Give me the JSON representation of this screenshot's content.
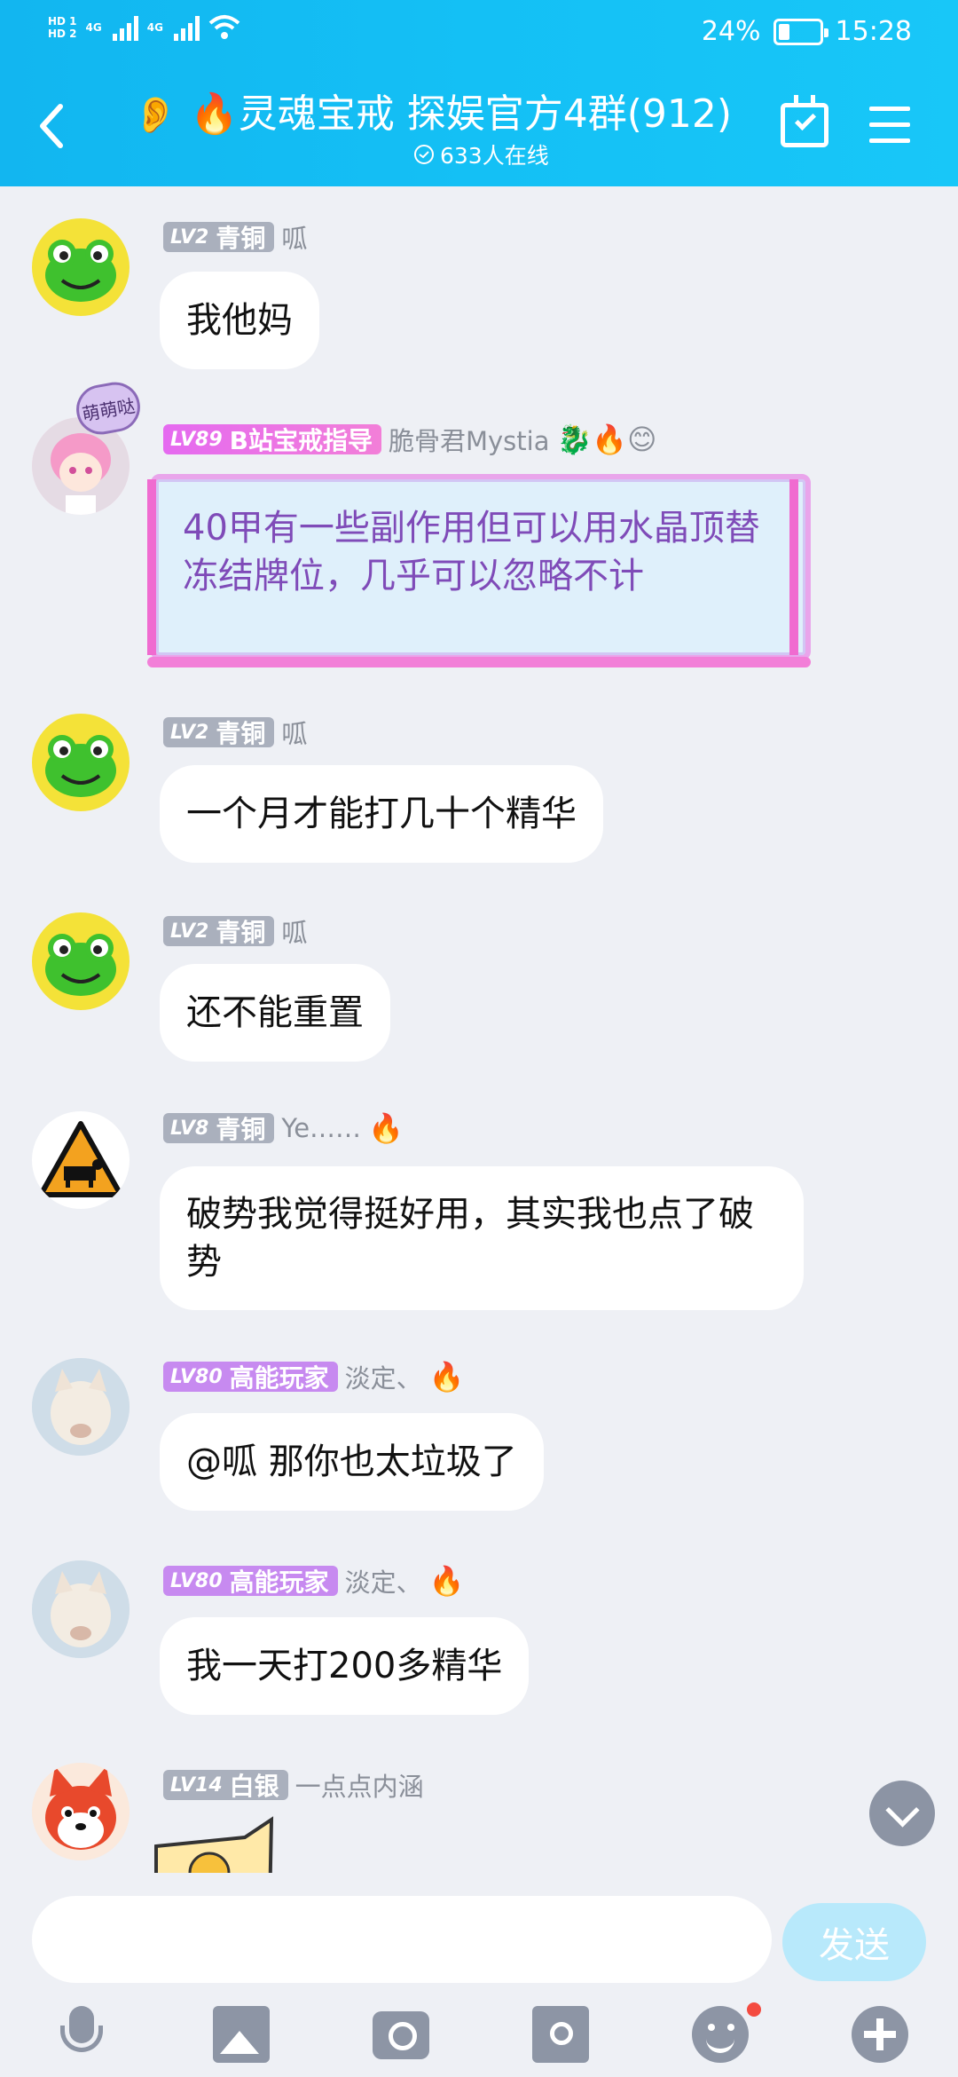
{
  "status": {
    "hd1": "HD 1",
    "hd2": "HD 2",
    "net": "4G",
    "net2": "4G",
    "battery": "24%",
    "time": "15:28"
  },
  "header": {
    "title": "🔥灵魂宝戒 探娱官方4群(912)",
    "online": "633人在线"
  },
  "messages": [
    {
      "lv": "LV2",
      "rank": "青铜",
      "name": "呱",
      "text": "我他妈"
    },
    {
      "lv": "LV89",
      "rank": "B站宝戒指导",
      "name": "脆骨君Mystia",
      "emojis": "🐉🔥😊",
      "text": "40甲有一些副作用但可以用水晶顶替冻结牌位，几乎可以忽略不计"
    },
    {
      "lv": "LV2",
      "rank": "青铜",
      "name": "呱",
      "text": "一个月才能打几十个精华"
    },
    {
      "lv": "LV2",
      "rank": "青铜",
      "name": "呱",
      "text": "还不能重置"
    },
    {
      "lv": "LV8",
      "rank": "青铜",
      "name": "Ye……",
      "emojis": "🔥",
      "text": "破势我觉得挺好用，其实我也点了破势"
    },
    {
      "lv": "LV80",
      "rank": "高能玩家",
      "name": "淡定、",
      "emojis": "🔥",
      "text": "@呱 那你也太垃圾了"
    },
    {
      "lv": "LV80",
      "rank": "高能玩家",
      "name": "淡定、",
      "emojis": "🔥",
      "text": "我一天打200多精华"
    },
    {
      "lv": "LV14",
      "rank": "白银",
      "name": "一点点内涵"
    }
  ],
  "avatar_badge": "萌萌哒",
  "input": {
    "placeholder": "",
    "send": "发送"
  },
  "colors": {
    "header": "#14bdf4",
    "accent_pink": "#f27fd8",
    "badge_gray": "#aab0bd",
    "badge_purple": "#c78af0"
  }
}
